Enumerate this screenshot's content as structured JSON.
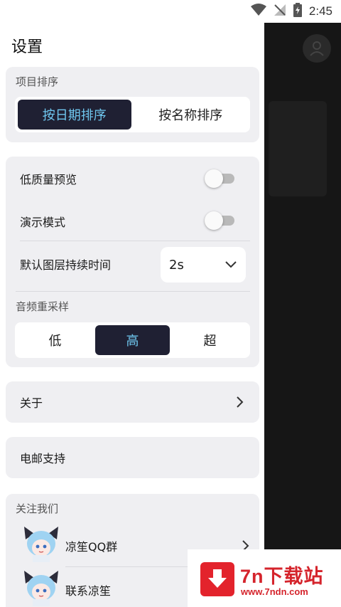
{
  "status_bar": {
    "time": "2:45"
  },
  "drawer": {
    "title": "设置"
  },
  "sort": {
    "label": "项目排序",
    "options": [
      "按日期排序",
      "按名称排序"
    ],
    "selected": "按日期排序"
  },
  "settings": {
    "low_quality_preview": {
      "label": "低质量预览",
      "on": false
    },
    "demo_mode": {
      "label": "演示模式",
      "on": false
    },
    "default_layer_duration": {
      "label": "默认图层持续时间",
      "value": "2s"
    }
  },
  "resample": {
    "label": "音频重采样",
    "options": [
      "低",
      "高",
      "超"
    ],
    "selected": "高"
  },
  "about": {
    "label": "关于"
  },
  "email": {
    "label": "电邮支持"
  },
  "follow": {
    "label": "关注我们",
    "items": [
      {
        "label": "凉笙QQ群"
      },
      {
        "label": "联系凉笙"
      }
    ]
  },
  "watermark": {
    "title": "7n下载站",
    "url": "www.7ndn.com"
  },
  "colors": {
    "accent_dark": "#1f2033",
    "accent_text": "#6fc7ef",
    "watermark_red": "#e3232c"
  }
}
